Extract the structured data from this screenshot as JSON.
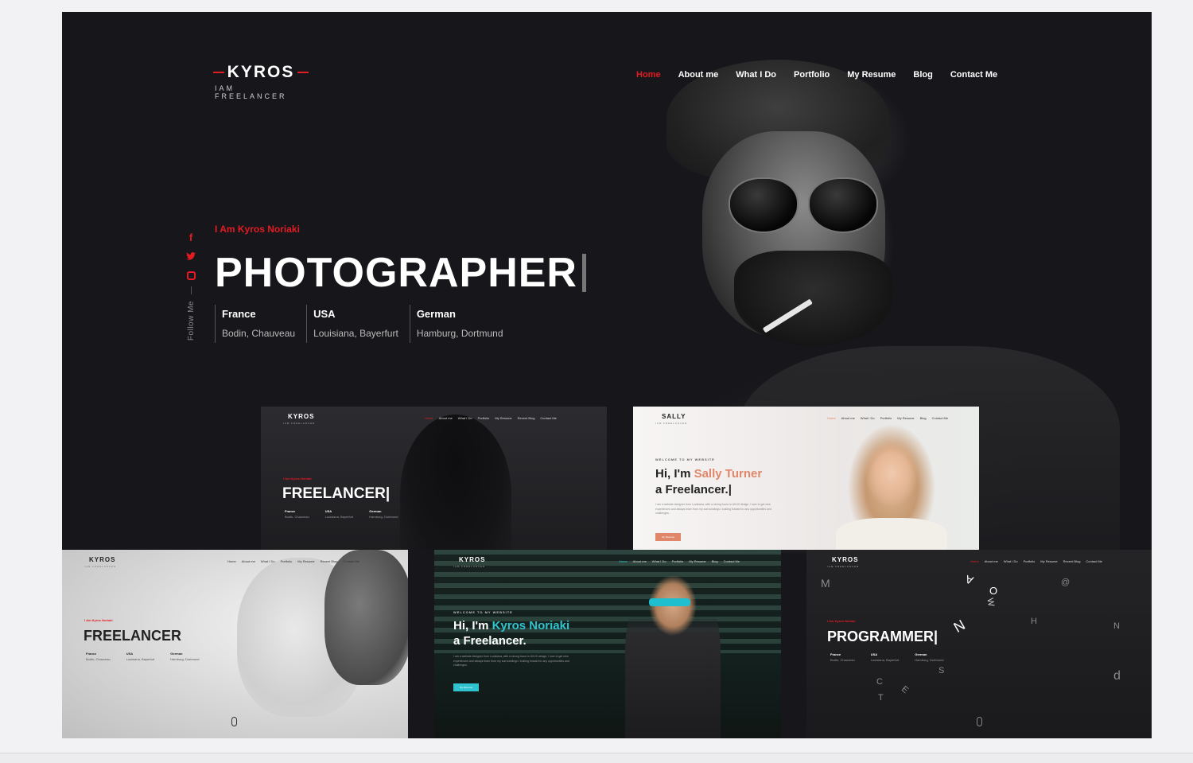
{
  "header": {
    "logo": "KYROS",
    "logo_sub": "IAM FREELANCER",
    "nav": [
      "Home",
      "About me",
      "What I Do",
      "Portfolio",
      "My Resume",
      "Blog",
      "Contact Me"
    ],
    "active_nav": "Home"
  },
  "hero": {
    "intro": "I Am Kyros Noriaki",
    "headline": "PHOTOGRAPHER",
    "follow": "Follow Me",
    "social_icons": [
      "facebook-icon",
      "twitter-icon",
      "instagram-icon"
    ],
    "locations": [
      {
        "country": "France",
        "cities": "Bodin, Chauveau"
      },
      {
        "country": "USA",
        "cities": "Louisiana, Bayerfurt"
      },
      {
        "country": "German",
        "cities": "Hamburg, Dortmund"
      }
    ]
  },
  "thumbs": {
    "t1": {
      "logo": "KYROS",
      "logo_sub": "IAM FREELANCER",
      "nav": [
        "Home",
        "About me",
        "What I Do",
        "Portfolio",
        "My Resume",
        "Recent Blog",
        "Contact Me"
      ],
      "label": "I Am Kyros Noriaki",
      "headline": "FREELANCER|",
      "locations": [
        [
          "France",
          "Bodin, Chauveau"
        ],
        [
          "USA",
          "Louisiana, Bayerfurt"
        ],
        [
          "German",
          "Hamburg, Dortmund"
        ]
      ]
    },
    "t2": {
      "logo": "SALLY",
      "logo_sub": "IAM FREELANCER",
      "nav": [
        "Home",
        "About me",
        "What I Do",
        "Portfolio",
        "My Resume",
        "Blog",
        "Contact Me"
      ],
      "label": "WELCOME TO MY WEBSITE",
      "line1": "Hi, I'm ",
      "name": "Sally Turner",
      "line2": "a Freelancer.|",
      "body": "I am a website designer from Louisiana, with a strong focus in UI/UX design. I love to get new experiences and always learn from my surroundings.I looking forward to any opportunities and challenges.",
      "button": "My Resume"
    },
    "t3": {
      "logo": "KYROS",
      "logo_sub": "IAM FREELANCER",
      "nav": [
        "Home",
        "About me",
        "What I Do",
        "Portfolio",
        "My Resume",
        "Recent Blog",
        "Contact Me"
      ],
      "label": "I Am Kyros Noriaki",
      "headline": "FREELANCER",
      "locations": [
        [
          "France",
          "Bodin, Chauveau"
        ],
        [
          "USA",
          "Louisiana, Bayerfurt"
        ],
        [
          "German",
          "Hamburg, Dortmund"
        ]
      ]
    },
    "t4": {
      "logo": "KYROS",
      "logo_sub": "IAM FREELANCER",
      "nav": [
        "Home",
        "About me",
        "What I Do",
        "Portfolio",
        "My Resume",
        "Blog",
        "Contact Me"
      ],
      "label": "WELCOME TO MY WEBSITE",
      "line1": "Hi, I'm ",
      "name": "Kyros Noriaki",
      "line2": "a Freelancer.",
      "body": "I am a website designer from Louisiana, with a strong focus in UI/UX design. I love to get new experiences and always learn from my surroundings.I looking forward to any opportunities and challenges.",
      "button": "My Resume"
    },
    "t5": {
      "logo": "KYROS",
      "logo_sub": "IAM FREELANCER",
      "nav": [
        "Home",
        "About me",
        "What I Do",
        "Portfolio",
        "My Resume",
        "Recent Blog",
        "Contact Me"
      ],
      "label": "I Am Kyros Noriaki",
      "headline": "PROGRAMMER|",
      "locations": [
        [
          "France",
          "Bodin, Chauveau"
        ],
        [
          "USA",
          "Louisiana, Bayerfurt"
        ],
        [
          "German",
          "Hamburg, Dortmund"
        ]
      ]
    }
  },
  "colors": {
    "accent": "#e31b23",
    "sally_accent": "#e0876a",
    "teal": "#2fc2cf",
    "bg": "#17171b"
  }
}
